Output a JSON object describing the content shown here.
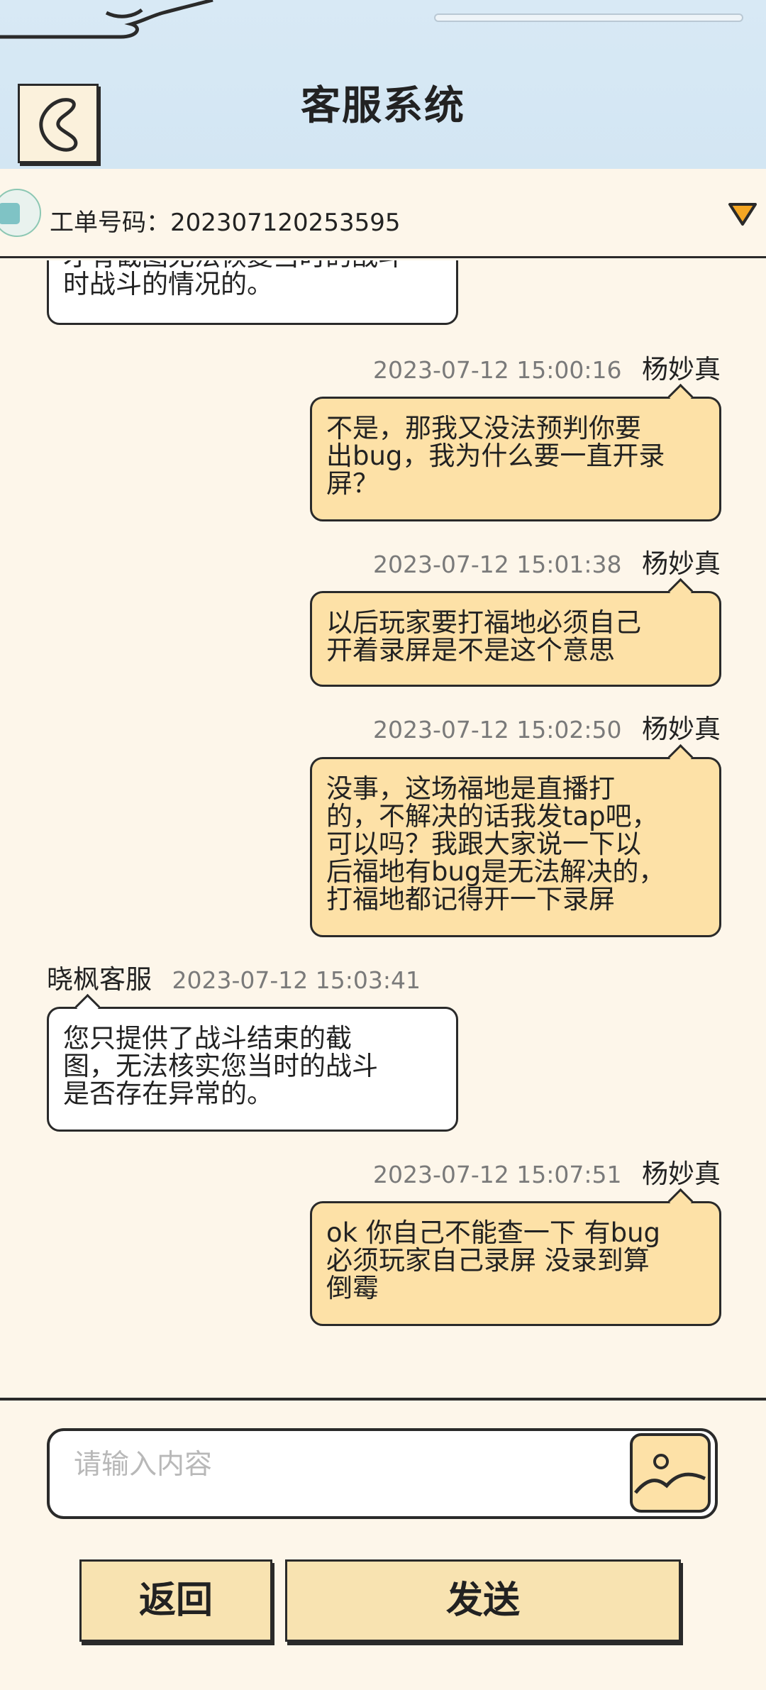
{
  "header": {
    "title": "客服系统"
  },
  "ticket": {
    "label": "工单号码：202307120253595"
  },
  "messages": [
    {
      "side": "left",
      "partial": true,
      "text_line1": "才有截图无法恢复当时的战斗",
      "text_line2": "时战斗的情况的。"
    },
    {
      "side": "right",
      "timestamp": "2023-07-12 15:00:16",
      "name": "杨妙真",
      "lines": [
        "不是，那我又没法预判你要",
        "出bug，我为什么要一直开录",
        "屏？"
      ]
    },
    {
      "side": "right",
      "timestamp": "2023-07-12 15:01:38",
      "name": "杨妙真",
      "lines": [
        "以后玩家要打福地必须自己",
        "开着录屏是不是这个意思"
      ]
    },
    {
      "side": "right",
      "timestamp": "2023-07-12 15:02:50",
      "name": "杨妙真",
      "lines": [
        "没事，这场福地是直播打",
        "的，不解决的话我发tap吧，",
        "可以吗？我跟大家说一下以",
        "后福地有bug是无法解决的，",
        "打福地都记得开一下录屏"
      ]
    },
    {
      "side": "left",
      "timestamp": "2023-07-12 15:03:41",
      "name": "晓枫客服",
      "lines": [
        "您只提供了战斗结束的截",
        "图，无法核实您当时的战斗",
        "是否存在异常的。"
      ]
    },
    {
      "side": "right",
      "timestamp": "2023-07-12 15:07:51",
      "name": "杨妙真",
      "lines": [
        "ok 你自己不能查一下 有bug",
        "必须玩家自己录屏 没录到算",
        "倒霉"
      ]
    }
  ],
  "input": {
    "placeholder": "请输入内容"
  },
  "buttons": {
    "back": "返回",
    "send": "发送"
  }
}
